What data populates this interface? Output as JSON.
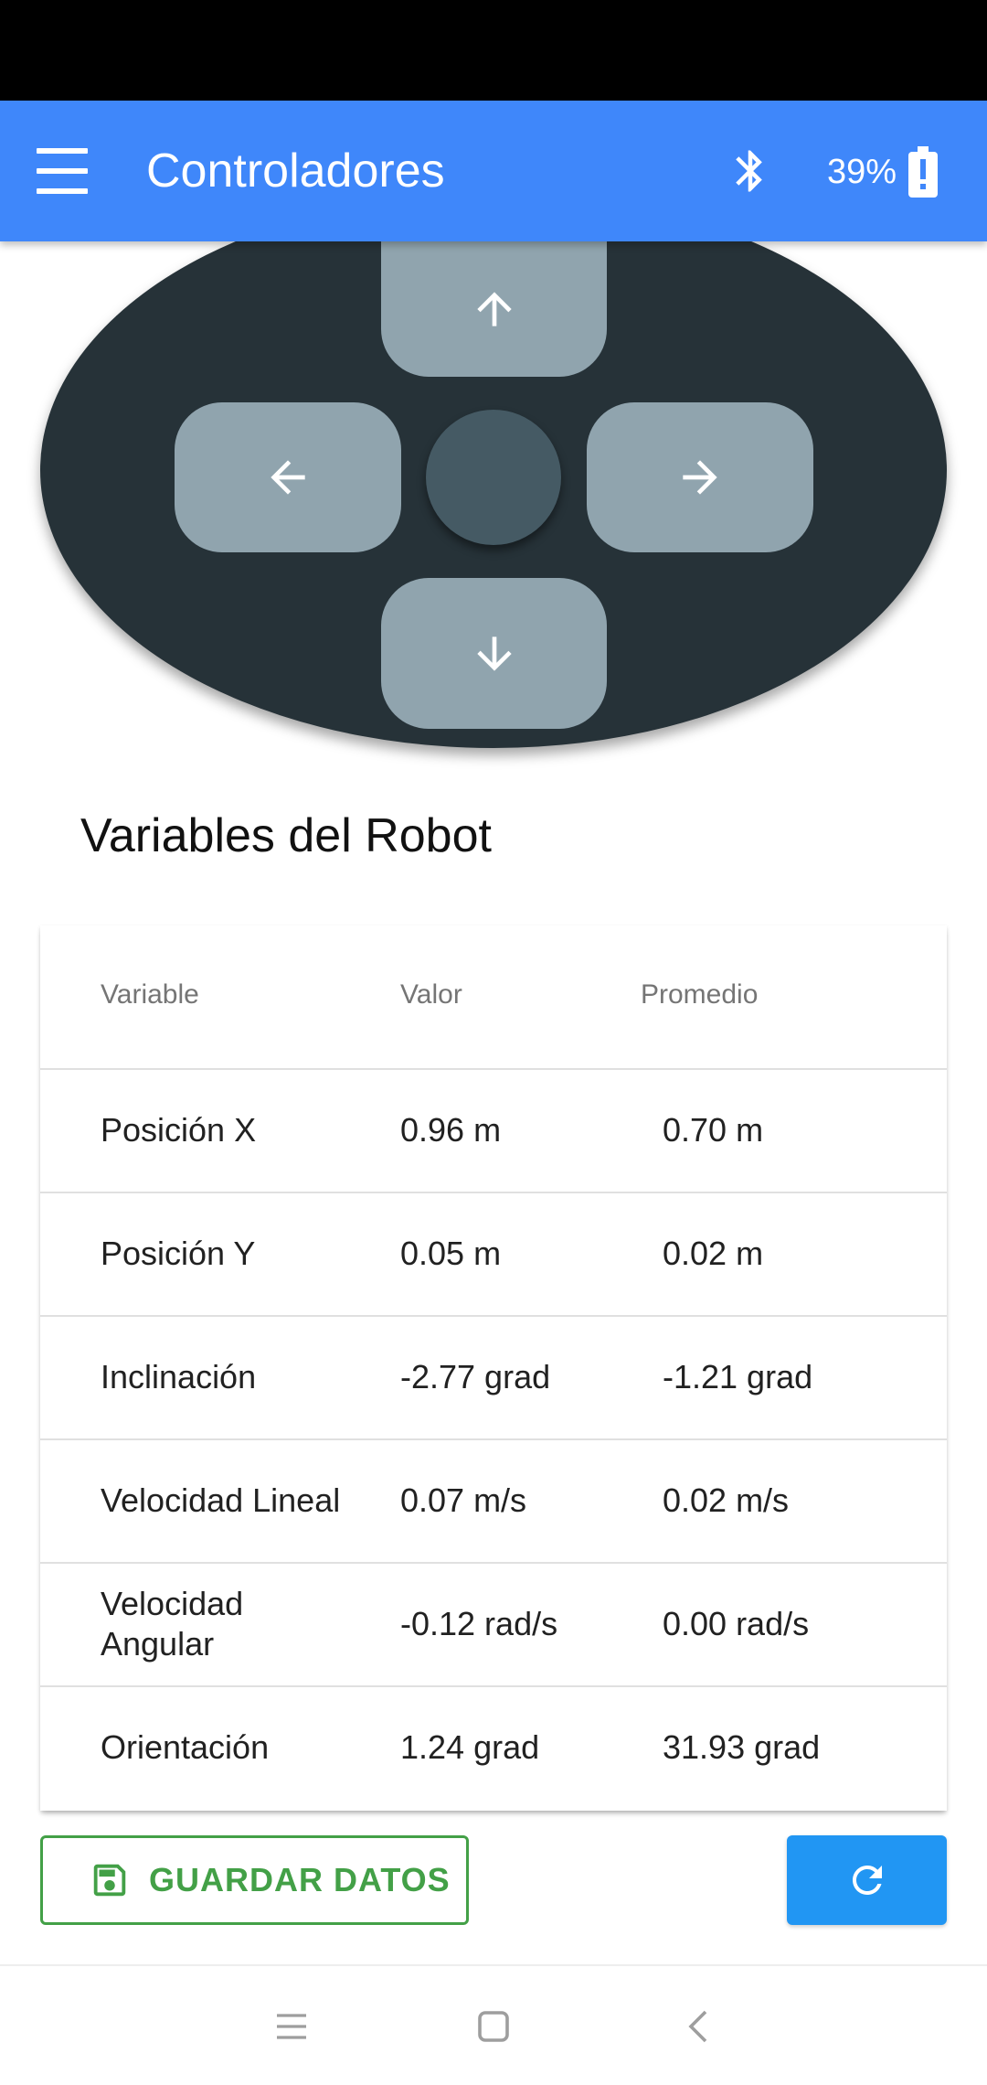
{
  "app_bar": {
    "title": "Controladores",
    "battery_percent": "39%",
    "color": "#3f87fa",
    "icons": [
      "menu-icon",
      "bluetooth-icon",
      "battery-alert-icon"
    ]
  },
  "dpad": {
    "icons": [
      "arrow-up-icon",
      "arrow-left-icon",
      "arrow-right-icon",
      "arrow-down-icon"
    ]
  },
  "section": {
    "title": "Variables del Robot"
  },
  "table": {
    "headers": [
      "Variable",
      "Valor",
      "Promedio"
    ],
    "rows": [
      {
        "variable": "Posición X",
        "valor": "0.96 m",
        "promedio": "0.70 m"
      },
      {
        "variable": "Posición Y",
        "valor": "0.05 m",
        "promedio": "0.02 m"
      },
      {
        "variable": "Inclinación",
        "valor": "-2.77 grad",
        "promedio": "-1.21 grad"
      },
      {
        "variable": "Velocidad Lineal",
        "valor": "0.07 m/s",
        "promedio": "0.02 m/s"
      },
      {
        "variable": "Velocidad Angular",
        "valor": "-0.12 rad/s",
        "promedio": "0.00 rad/s"
      },
      {
        "variable": "Orientación",
        "valor": "1.24 grad",
        "promedio": "31.93 grad"
      }
    ]
  },
  "actions": {
    "save_label": "GUARDAR DATOS",
    "save_color": "#43a047",
    "refresh_color": "#2196f3"
  }
}
